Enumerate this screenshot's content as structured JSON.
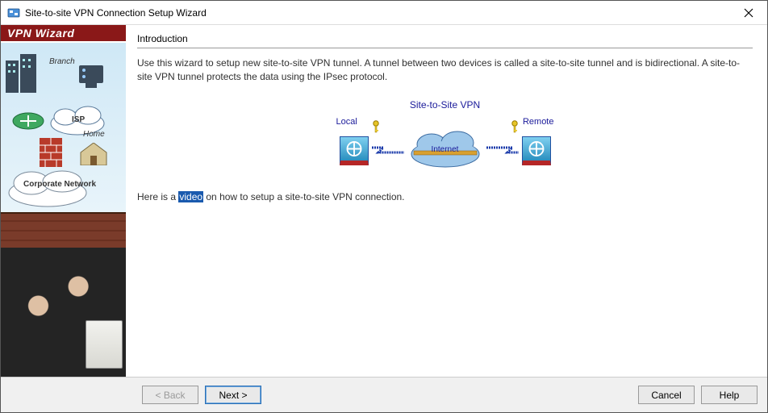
{
  "window": {
    "title": "Site-to-site VPN Connection Setup Wizard"
  },
  "sidebar": {
    "banner": "VPN Wizard",
    "labels": {
      "branch": "Branch",
      "isp": "ISP",
      "home": "Home",
      "corporate": "Corporate Network"
    }
  },
  "main": {
    "heading": "Introduction",
    "intro_text": "Use this wizard to setup new site-to-site VPN tunnel. A tunnel between two devices is called a site-to-site tunnel and is bidirectional. A site-to-site VPN tunnel protects the data using the IPsec protocol.",
    "diagram": {
      "title": "Site-to-Site VPN",
      "local_label": "Local",
      "remote_label": "Remote",
      "internet_label": "Internet"
    },
    "video_prefix": "Here is a ",
    "video_link": "video",
    "video_suffix": " on how to setup a site-to-site VPN connection."
  },
  "footer": {
    "back": "< Back",
    "next": "Next >",
    "cancel": "Cancel",
    "help": "Help"
  }
}
